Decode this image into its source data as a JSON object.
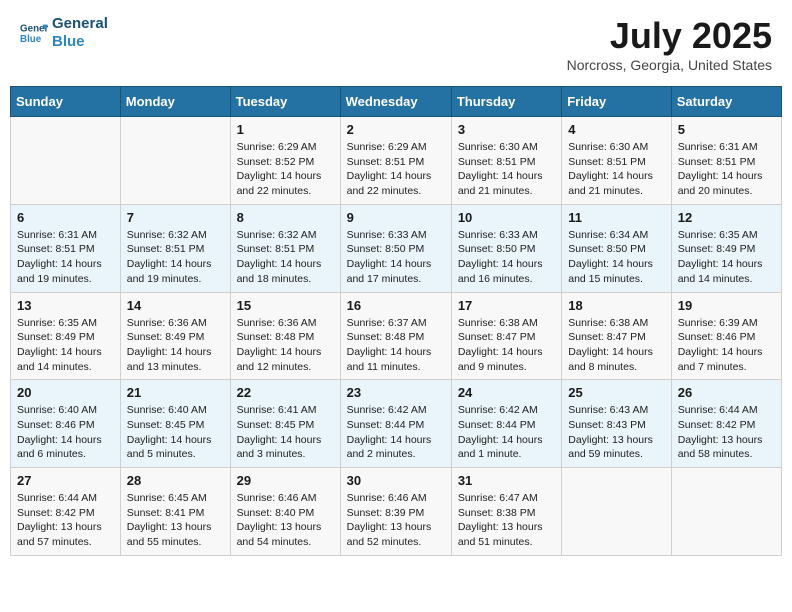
{
  "header": {
    "logo_line1": "General",
    "logo_line2": "Blue",
    "month_title": "July 2025",
    "location": "Norcross, Georgia, United States"
  },
  "days_of_week": [
    "Sunday",
    "Monday",
    "Tuesday",
    "Wednesday",
    "Thursday",
    "Friday",
    "Saturday"
  ],
  "weeks": [
    [
      {
        "day": "",
        "details": ""
      },
      {
        "day": "",
        "details": ""
      },
      {
        "day": "1",
        "details": "Sunrise: 6:29 AM\nSunset: 8:52 PM\nDaylight: 14 hours and 22 minutes."
      },
      {
        "day": "2",
        "details": "Sunrise: 6:29 AM\nSunset: 8:51 PM\nDaylight: 14 hours and 22 minutes."
      },
      {
        "day": "3",
        "details": "Sunrise: 6:30 AM\nSunset: 8:51 PM\nDaylight: 14 hours and 21 minutes."
      },
      {
        "day": "4",
        "details": "Sunrise: 6:30 AM\nSunset: 8:51 PM\nDaylight: 14 hours and 21 minutes."
      },
      {
        "day": "5",
        "details": "Sunrise: 6:31 AM\nSunset: 8:51 PM\nDaylight: 14 hours and 20 minutes."
      }
    ],
    [
      {
        "day": "6",
        "details": "Sunrise: 6:31 AM\nSunset: 8:51 PM\nDaylight: 14 hours and 19 minutes."
      },
      {
        "day": "7",
        "details": "Sunrise: 6:32 AM\nSunset: 8:51 PM\nDaylight: 14 hours and 19 minutes."
      },
      {
        "day": "8",
        "details": "Sunrise: 6:32 AM\nSunset: 8:51 PM\nDaylight: 14 hours and 18 minutes."
      },
      {
        "day": "9",
        "details": "Sunrise: 6:33 AM\nSunset: 8:50 PM\nDaylight: 14 hours and 17 minutes."
      },
      {
        "day": "10",
        "details": "Sunrise: 6:33 AM\nSunset: 8:50 PM\nDaylight: 14 hours and 16 minutes."
      },
      {
        "day": "11",
        "details": "Sunrise: 6:34 AM\nSunset: 8:50 PM\nDaylight: 14 hours and 15 minutes."
      },
      {
        "day": "12",
        "details": "Sunrise: 6:35 AM\nSunset: 8:49 PM\nDaylight: 14 hours and 14 minutes."
      }
    ],
    [
      {
        "day": "13",
        "details": "Sunrise: 6:35 AM\nSunset: 8:49 PM\nDaylight: 14 hours and 14 minutes."
      },
      {
        "day": "14",
        "details": "Sunrise: 6:36 AM\nSunset: 8:49 PM\nDaylight: 14 hours and 13 minutes."
      },
      {
        "day": "15",
        "details": "Sunrise: 6:36 AM\nSunset: 8:48 PM\nDaylight: 14 hours and 12 minutes."
      },
      {
        "day": "16",
        "details": "Sunrise: 6:37 AM\nSunset: 8:48 PM\nDaylight: 14 hours and 11 minutes."
      },
      {
        "day": "17",
        "details": "Sunrise: 6:38 AM\nSunset: 8:47 PM\nDaylight: 14 hours and 9 minutes."
      },
      {
        "day": "18",
        "details": "Sunrise: 6:38 AM\nSunset: 8:47 PM\nDaylight: 14 hours and 8 minutes."
      },
      {
        "day": "19",
        "details": "Sunrise: 6:39 AM\nSunset: 8:46 PM\nDaylight: 14 hours and 7 minutes."
      }
    ],
    [
      {
        "day": "20",
        "details": "Sunrise: 6:40 AM\nSunset: 8:46 PM\nDaylight: 14 hours and 6 minutes."
      },
      {
        "day": "21",
        "details": "Sunrise: 6:40 AM\nSunset: 8:45 PM\nDaylight: 14 hours and 5 minutes."
      },
      {
        "day": "22",
        "details": "Sunrise: 6:41 AM\nSunset: 8:45 PM\nDaylight: 14 hours and 3 minutes."
      },
      {
        "day": "23",
        "details": "Sunrise: 6:42 AM\nSunset: 8:44 PM\nDaylight: 14 hours and 2 minutes."
      },
      {
        "day": "24",
        "details": "Sunrise: 6:42 AM\nSunset: 8:44 PM\nDaylight: 14 hours and 1 minute."
      },
      {
        "day": "25",
        "details": "Sunrise: 6:43 AM\nSunset: 8:43 PM\nDaylight: 13 hours and 59 minutes."
      },
      {
        "day": "26",
        "details": "Sunrise: 6:44 AM\nSunset: 8:42 PM\nDaylight: 13 hours and 58 minutes."
      }
    ],
    [
      {
        "day": "27",
        "details": "Sunrise: 6:44 AM\nSunset: 8:42 PM\nDaylight: 13 hours and 57 minutes."
      },
      {
        "day": "28",
        "details": "Sunrise: 6:45 AM\nSunset: 8:41 PM\nDaylight: 13 hours and 55 minutes."
      },
      {
        "day": "29",
        "details": "Sunrise: 6:46 AM\nSunset: 8:40 PM\nDaylight: 13 hours and 54 minutes."
      },
      {
        "day": "30",
        "details": "Sunrise: 6:46 AM\nSunset: 8:39 PM\nDaylight: 13 hours and 52 minutes."
      },
      {
        "day": "31",
        "details": "Sunrise: 6:47 AM\nSunset: 8:38 PM\nDaylight: 13 hours and 51 minutes."
      },
      {
        "day": "",
        "details": ""
      },
      {
        "day": "",
        "details": ""
      }
    ]
  ]
}
